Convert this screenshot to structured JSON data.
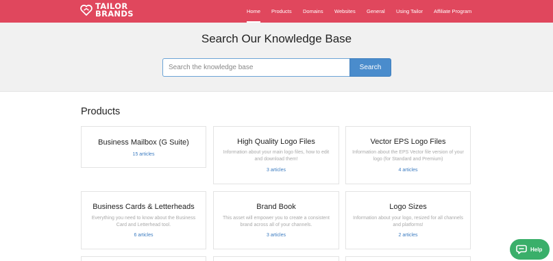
{
  "brand": {
    "line1": "TAILOR",
    "line2": "BRANDS",
    "colors": {
      "nav_bg": "#e0475d",
      "link": "#3b7bc0",
      "search_button": "#4a8ccc",
      "help_button": "#3aaf6a"
    }
  },
  "nav": {
    "items": [
      {
        "label": "Home",
        "active": true
      },
      {
        "label": "Products",
        "active": false
      },
      {
        "label": "Domains",
        "active": false
      },
      {
        "label": "Websites",
        "active": false
      },
      {
        "label": "General",
        "active": false
      },
      {
        "label": "Using Tailor",
        "active": false
      },
      {
        "label": "Affiliate Program",
        "active": false
      }
    ]
  },
  "hero": {
    "title": "Search Our Knowledge Base",
    "search_placeholder": "Search the knowledge base",
    "search_value": "",
    "search_button": "Search"
  },
  "section": {
    "title": "Products",
    "cards": [
      {
        "title": "Business Mailbox (G Suite)",
        "description": "",
        "count": "15 articles"
      },
      {
        "title": "High Quality Logo Files",
        "description": "Information about your main logo files, how to edit and download them!",
        "count": "3 articles"
      },
      {
        "title": "Vector EPS Logo Files",
        "description": "Information about the EPS Vector file version of your logo (for Standard and Premium)",
        "count": "4 articles"
      },
      {
        "title": "Business Cards & Letterheads",
        "description": "Everything you need to know about the Business Card and Letterhead tool.",
        "count": "6 articles"
      },
      {
        "title": "Brand Book",
        "description": "This asset will empower you to create a consistent brand across all of your channels.",
        "count": "3 articles"
      },
      {
        "title": "Logo Sizes",
        "description": "Information about your logo, resized for all channels and platforms!",
        "count": "2 articles"
      }
    ]
  },
  "help": {
    "label": "Help",
    "icon": "chat-bubble-icon"
  }
}
